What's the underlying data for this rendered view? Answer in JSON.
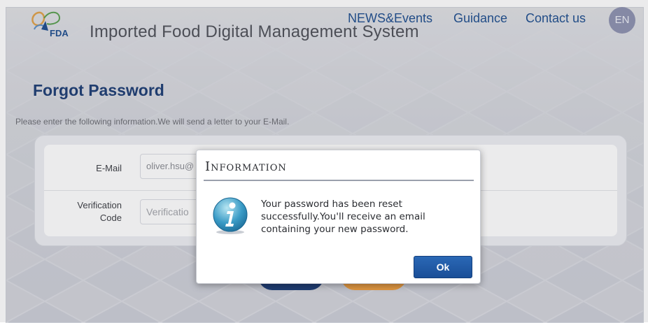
{
  "header": {
    "logo_text": "FDA",
    "site_title": "Imported Food Digital Management System",
    "nav": {
      "news": "NEWS&Events",
      "guidance": "Guidance",
      "contact": "Contact us"
    },
    "language": "EN"
  },
  "main": {
    "heading": "Forgot Password",
    "instruction": "Please enter the following information.We will send a letter to your E-Mail.",
    "form": {
      "email_label": "E-Mail",
      "email_value": "oliver.hsu@",
      "code_label_line1": "Verification",
      "code_label_line2": "Code",
      "code_placeholder": "Verificatio"
    }
  },
  "dialog": {
    "title": "Information",
    "message": "Your password has been reset successfully.You'll receive an email containing your new password.",
    "ok_label": "Ok",
    "icon": "info-icon"
  },
  "colors": {
    "brand_navy": "#1d3e74",
    "nav_blue": "#1f4f8f",
    "accent_orange": "#f0a040",
    "ok_blue": "#1a4e98"
  }
}
